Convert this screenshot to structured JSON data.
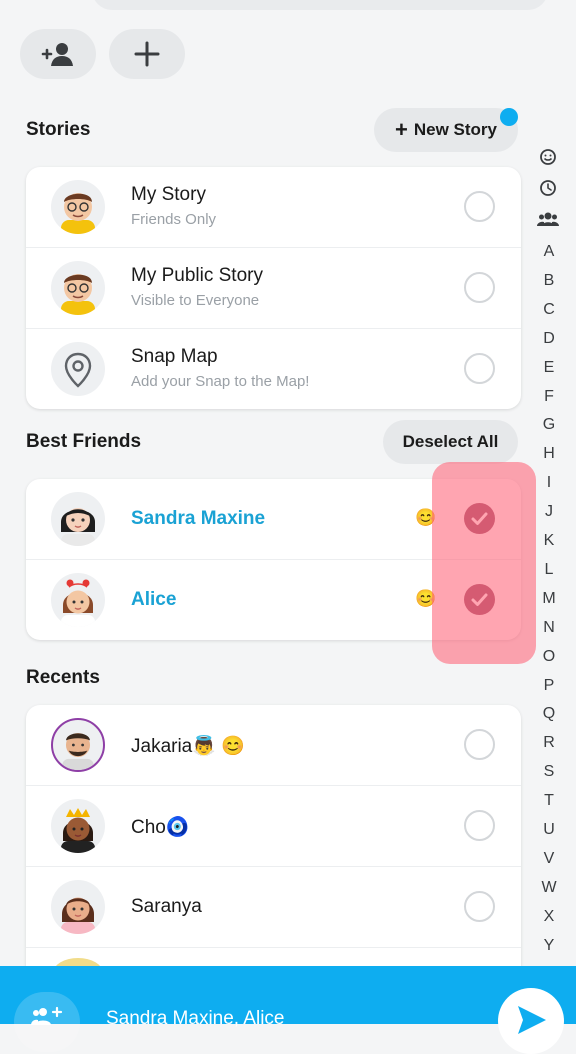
{
  "stories": {
    "title": "Stories",
    "new_story_label": "New Story",
    "items": [
      {
        "title": "My Story",
        "subtitle": "Friends Only"
      },
      {
        "title": "My Public Story",
        "subtitle": "Visible to Everyone"
      },
      {
        "title": "Snap Map",
        "subtitle": "Add your Snap to the Map!"
      }
    ]
  },
  "best_friends": {
    "title": "Best Friends",
    "deselect_label": "Deselect All",
    "items": [
      {
        "name": "Sandra Maxine",
        "emoji": "😊",
        "selected": true
      },
      {
        "name": "Alice",
        "emoji": "😊",
        "selected": true
      }
    ]
  },
  "recents": {
    "title": "Recents",
    "items": [
      {
        "name": "Jakaria👼 😊"
      },
      {
        "name": "Cho🧿"
      },
      {
        "name": "Saranya"
      }
    ]
  },
  "index_letters": [
    "A",
    "B",
    "C",
    "D",
    "E",
    "F",
    "G",
    "H",
    "I",
    "J",
    "K",
    "L",
    "M",
    "N",
    "O",
    "P",
    "Q",
    "R",
    "S",
    "T",
    "U",
    "V",
    "W",
    "X",
    "Y"
  ],
  "send_bar": {
    "recipients": "Sandra Maxine, Alice"
  },
  "colors": {
    "accent": "#0eadf0",
    "best_friend_name": "#1aa2d4",
    "checked": "#9b4f6a"
  }
}
